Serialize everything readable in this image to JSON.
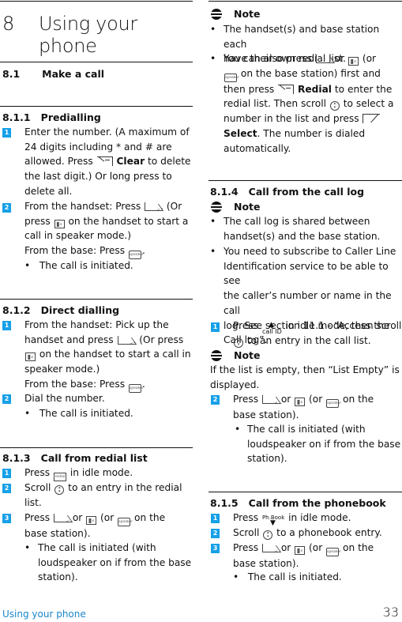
{
  "chapter": {
    "number": "8",
    "title": "Using your phone"
  },
  "section_8_1": {
    "number": "8.1",
    "title": "Make a call"
  },
  "s811": {
    "number": "8.1.1",
    "title": "Predialling",
    "step1": {
      "badge": "1",
      "t1": "Enter the number. (A maximum of",
      "t2": "24 digits including * and # are",
      "t3a": "allowed. Press",
      "t3b": "Clear",
      "t3c": " to delete",
      "t4": "the last digit.) Or long press to",
      "t5": "delete all."
    },
    "step2": {
      "badge": "2",
      "t1a": "From the handset: Press",
      "t1b": ". (Or",
      "t2a": "press",
      "t2b": "on the handset to start a",
      "t3": "call in speaker mode.)",
      "t4a": "From the base: Press",
      "t4b": "."
    },
    "bullet": "The call is initiated."
  },
  "s812": {
    "number": "8.1.2",
    "title": "Direct dialling",
    "step1": {
      "badge": "1",
      "t1": "From the handset: Pick up the",
      "t2a": "handset and press",
      "t2b": ". (Or press",
      "t3b": "on the handset to start a call in",
      "t4": "speaker mode.)",
      "t5a": "From the base: Press",
      "t5b": "."
    },
    "step2": {
      "badge": "2",
      "t1": "Dial the number."
    },
    "bullet": "The call is initiated."
  },
  "s813": {
    "number": "8.1.3",
    "title": "Call from redial list",
    "step1": {
      "badge": "1",
      "a": "Press",
      "b": "in idle mode."
    },
    "step2": {
      "badge": "2",
      "a": "Scroll",
      "b": "to an entry in the redial",
      "c": "list."
    },
    "step3": {
      "badge": "3",
      "a": "Press",
      "or1": "or",
      "b": "(or",
      "c": "on the",
      "d": "base station)."
    },
    "bullet": {
      "l1": "The call is initiated (with",
      "l2": "loudspeaker on if from the base",
      "l3": "station)."
    }
  },
  "note1": {
    "label": "Note",
    "b1": {
      "l1": "The handset(s) and base station each",
      "l2": "have their own redial list."
    },
    "b2": {
      "l1a": "You can also press",
      "l1or": "or",
      "l1b": "(or",
      "l2": "on the base station) first and",
      "l3a": "then press",
      "l3b": "Redial",
      "l3c": " to enter the",
      "l4a": "redial list. Then scroll",
      "l4b": "to select a",
      "l5": "number in the list and press",
      "l6a": "Select",
      "l6b": ". The number is dialed",
      "l7": "automatically."
    }
  },
  "s814": {
    "number": "8.1.4",
    "title": "Call from the call log",
    "note_label": "Note",
    "n1": {
      "l1": "The call log is shared between",
      "l2": "handset(s) and the base station."
    },
    "n2": {
      "l1": "You need to subscribe to Caller Line",
      "l2": "Identification service to be able to see",
      "l3": "the caller’s number or name in the call",
      "l4": "log. See section 11.1 - “Access the",
      "l5": "Call log”."
    },
    "step1": {
      "badge": "1",
      "a": "Press",
      "b": "in idle mode, then scroll",
      "c": "to an entry in the call list."
    },
    "note2_label": "Note",
    "note2": {
      "l1": "If the list is empty, then “List Empty” is",
      "l2": "displayed."
    },
    "step2": {
      "badge": "2",
      "a": "Press",
      "or1": "or",
      "b": "(or",
      "c": "on the",
      "d": "base station)."
    },
    "bullet": {
      "l1": "The call is initiated (with",
      "l2": "loudspeaker on if from the base",
      "l3": "station)."
    }
  },
  "s815": {
    "number": "8.1.5",
    "title": "Call from the phonebook",
    "step1": {
      "badge": "1",
      "a": "Press",
      "b": "in idle mode."
    },
    "step2": {
      "badge": "2",
      "a": "Scroll",
      "b": "to a phonebook entry."
    },
    "step3": {
      "badge": "3",
      "a": "Press",
      "or1": "or",
      "b": "(or",
      "c": "on the",
      "d": "base station)."
    },
    "bullet": "The call is initiated."
  },
  "icons": {
    "talk": "TALK",
    "speaker": "speaker",
    "redial": "redial",
    "speaker_glyph": "▮‹",
    "callid": "call ID",
    "phbook": "Ph.Book"
  },
  "footer": {
    "section_title": "Using your phone",
    "page_number": "33"
  },
  "colors": {
    "accent": "#16a0e8",
    "footer_text": "#1a86c8"
  }
}
